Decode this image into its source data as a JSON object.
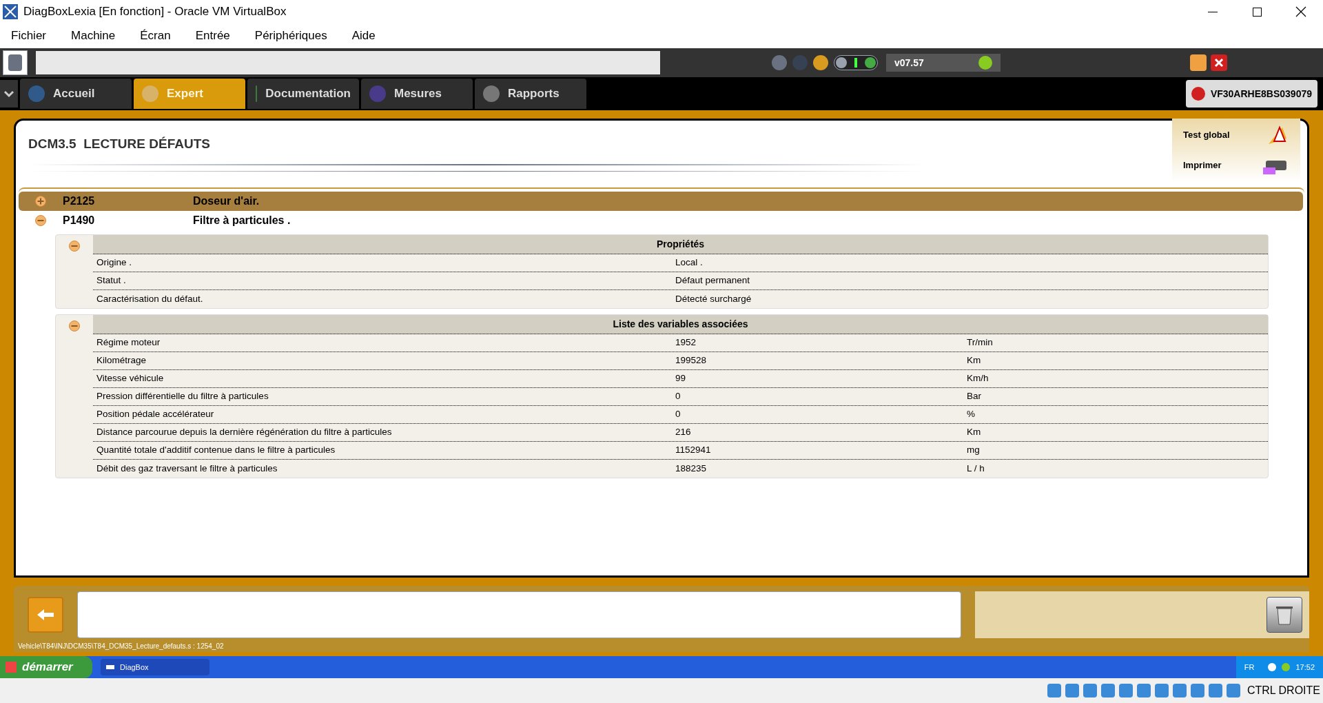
{
  "window": {
    "title": "DiagBoxLexia [En fonction] - Oracle VM VirtualBox"
  },
  "menu": [
    "Fichier",
    "Machine",
    "Écran",
    "Entrée",
    "Périphériques",
    "Aide"
  ],
  "toolbar": {
    "version": "v07.57"
  },
  "tabs": [
    {
      "label": "Accueil",
      "selected": false
    },
    {
      "label": "Expert",
      "selected": true
    },
    {
      "label": "Documentation",
      "selected": false
    },
    {
      "label": "Mesures",
      "selected": false
    },
    {
      "label": "Rapports",
      "selected": false
    }
  ],
  "vin": "VF30ARHE8BS039079",
  "page_title": "DCM3.5  LECTURE DÉFAUTS",
  "side_actions": [
    "Test global",
    "Imprimer"
  ],
  "faults": [
    {
      "code": "P2125",
      "description": "Doseur d'air.",
      "selected": true,
      "expanded": false
    },
    {
      "code": "P1490",
      "description": "Filtre à particules .",
      "selected": false,
      "expanded": true,
      "sections": [
        {
          "title": "Propriétés",
          "expanded": true,
          "rows": [
            [
              "Origine .",
              "Local ."
            ],
            [
              "Statut .",
              "Défaut permanent"
            ],
            [
              "Caractérisation du défaut.",
              "Détecté surchargé"
            ]
          ]
        },
        {
          "title": "Liste des variables associées",
          "expanded": true,
          "rows": [
            [
              "Régime moteur",
              "1952",
              "Tr/min"
            ],
            [
              "Kilométrage",
              "199528",
              "Km"
            ],
            [
              "Vitesse véhicule",
              "99",
              "Km/h"
            ],
            [
              "Pression différentielle du filtre à particules",
              "0",
              "Bar"
            ],
            [
              "Position pédale accélérateur",
              "0",
              "%"
            ],
            [
              "Distance parcourue depuis la dernière régénération du filtre à particules",
              "216",
              "Km"
            ],
            [
              "Quantité totale d'additif contenue dans le filtre à particules",
              "1152941",
              "mg"
            ],
            [
              "Débit des gaz traversant le filtre à particules",
              "188235",
              "L / h"
            ]
          ]
        }
      ]
    }
  ],
  "status_path": "Vehicle\\T84\\INJ\\DCM35\\T84_DCM35_Lecture_defauts.s : 1254_02",
  "taskbar": {
    "start": "démarrer",
    "task": "DiagBox",
    "lang": "FR",
    "clock": "17:52"
  },
  "vbox_status": "CTRL DROITE"
}
